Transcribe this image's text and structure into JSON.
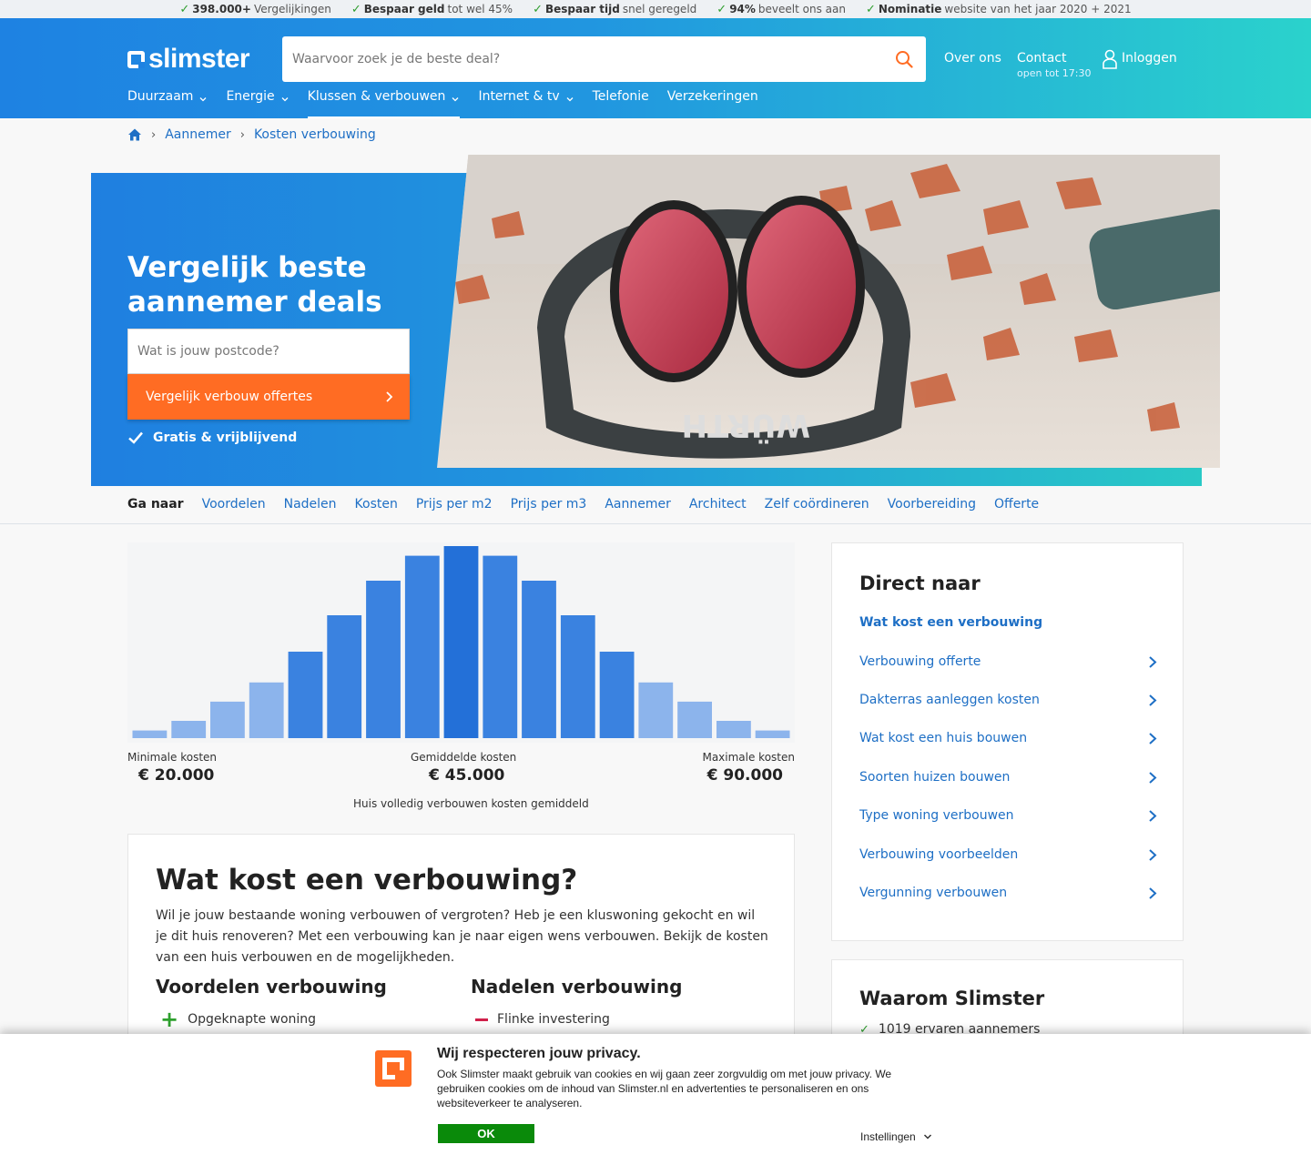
{
  "usp": [
    {
      "bold": "398.000+",
      "text": "Vergelijkingen"
    },
    {
      "bold": "Bespaar geld",
      "text": "tot wel 45%"
    },
    {
      "bold": "Bespaar tijd",
      "text": "snel geregeld"
    },
    {
      "bold": "94%",
      "text": "beveelt ons aan"
    },
    {
      "bold": "Nominatie",
      "text": "website van het jaar 2020 + 2021"
    }
  ],
  "header": {
    "logo": "slimster",
    "search_placeholder": "Waarvoor zoek je de beste deal?",
    "about": "Over ons",
    "contact": "Contact",
    "contact_hours": "open tot 17:30",
    "login": "Inloggen"
  },
  "nav": [
    {
      "label": "Duurzaam",
      "dropdown": true
    },
    {
      "label": "Energie",
      "dropdown": true
    },
    {
      "label": "Klussen & verbouwen",
      "dropdown": true,
      "active": true
    },
    {
      "label": "Internet & tv",
      "dropdown": true
    },
    {
      "label": "Telefonie",
      "dropdown": false
    },
    {
      "label": "Verzekeringen",
      "dropdown": false
    }
  ],
  "breadcrumb": [
    "Aannemer",
    "Kosten verbouwing"
  ],
  "hero": {
    "title": "Vergelijk beste aannemer deals",
    "postcode_placeholder": "Wat is jouw postcode?",
    "button": "Vergelijk verbouw offertes",
    "free": "Gratis & vrijblijvend"
  },
  "ganaar": {
    "label": "Ga naar",
    "links": [
      "Voordelen",
      "Nadelen",
      "Kosten",
      "Prijs per m2",
      "Prijs per m3",
      "Aannemer",
      "Architect",
      "Zelf coördineren",
      "Voorbereiding",
      "Offerte"
    ]
  },
  "chart_data": {
    "type": "bar",
    "values": [
      4,
      9,
      19,
      29,
      45,
      64,
      82,
      95,
      100,
      95,
      82,
      64,
      45,
      29,
      19,
      9,
      4
    ],
    "highlight_index": 8,
    "ylim": [
      0,
      100
    ],
    "min_label": "Minimale kosten",
    "min_value": "€ 20.000",
    "avg_label": "Gemiddelde kosten",
    "avg_value": "€ 45.000",
    "max_label": "Maximale kosten",
    "max_value": "€ 90.000",
    "caption": "Huis volledig verbouwen kosten gemiddeld",
    "bar_color": "#3a82e0",
    "highlight_color": "#2370d8",
    "edge_color": "#8cb4ec"
  },
  "article": {
    "title": "Wat kost een verbouwing?",
    "intro": "Wil je jouw bestaande woning verbouwen of vergroten? Heb je een kluswoning gekocht en wil je dit huis renoveren? Met een verbouwing kan je naar eigen wens verbouwen. Bekijk de kosten van een huis verbouwen en de mogelijkheden.",
    "pros_title": "Voordelen verbouwing",
    "pros": [
      "Opgeknapte woning"
    ],
    "cons_title": "Nadelen verbouwing",
    "cons": [
      "Flinke investering"
    ]
  },
  "sidebar": {
    "title": "Direct naar",
    "active": "Wat kost een verbouwing",
    "links": [
      "Verbouwing offerte",
      "Dakterras aanleggen kosten",
      "Wat kost een huis bouwen",
      "Soorten huizen bouwen",
      "Type woning verbouwen",
      "Verbouwing voorbeelden",
      "Vergunning verbouwen"
    ]
  },
  "why": {
    "title": "Waarom Slimster",
    "items": [
      "1019 ervaren aannemers"
    ]
  },
  "cookie": {
    "title": "Wij respecteren jouw privacy.",
    "text": "Ook Slimster maakt gebruik van cookies en wij gaan zeer zorgvuldig om met jouw privacy. We gebruiken cookies om de inhoud van Slimster.nl en advertenties te personaliseren en ons websiteverkeer te analyseren.",
    "ok": "OK",
    "settings": "Instellingen"
  },
  "colors": {
    "brand_blue": "#1e82e2",
    "accent_orange": "#ff6c23",
    "link_blue": "#1e6fc5"
  }
}
